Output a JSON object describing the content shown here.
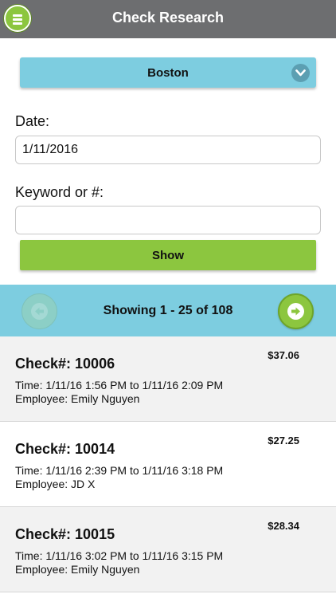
{
  "header": {
    "title": "Check Research",
    "menu_icon": "hamburger-menu-icon"
  },
  "location": {
    "value": "Boston",
    "dropdown_icon": "chevron-down-icon"
  },
  "date": {
    "label": "Date:",
    "value": "1/11/2016"
  },
  "keyword": {
    "label": "Keyword or #:",
    "value": ""
  },
  "show_button": {
    "label": "Show"
  },
  "pager": {
    "text": "Showing 1 - 25 of 108",
    "prev_icon": "arrow-left-icon",
    "next_icon": "arrow-right-icon"
  },
  "checks": [
    {
      "number": "Check#: 10006",
      "amount": "$37.06",
      "time": "Time: 1/11/16 1:56 PM to 1/11/16 2:09 PM",
      "employee": "Employee: Emily Nguyen"
    },
    {
      "number": "Check#: 10014",
      "amount": "$27.25",
      "time": "Time: 1/11/16 2:39 PM to 1/11/16 3:18 PM",
      "employee": "Employee: JD X"
    },
    {
      "number": "Check#: 10015",
      "amount": "$28.34",
      "time": "Time: 1/11/16 3:02 PM to 1/11/16 3:15 PM",
      "employee": "Employee: Emily Nguyen"
    }
  ],
  "colors": {
    "header_bg": "#6d6e70",
    "accent_green": "#8cc63f",
    "accent_blue": "#7dcde0"
  }
}
